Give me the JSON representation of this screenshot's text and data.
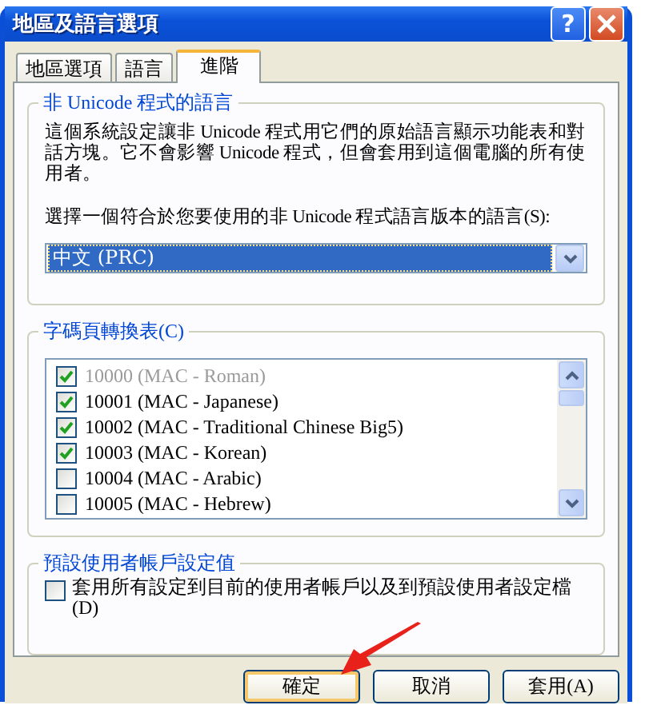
{
  "window": {
    "title": "地區及語言選項"
  },
  "title_buttons": [
    {
      "kind": "help",
      "label": "?"
    },
    {
      "kind": "close"
    }
  ],
  "tabs": [
    {
      "label": "地區選項",
      "selected": false
    },
    {
      "label": "語言",
      "selected": false
    },
    {
      "label": "進階",
      "selected": true
    }
  ],
  "language_group": {
    "legend": "非 Unicode 程式的語言",
    "description": "這個系統設定讓非 Unicode 程式用它們的原始語言顯示功能表和對話方塊。它不會影響 Unicode 程式，但會套用到這個電腦的所有使用者。",
    "prompt": "選擇一個符合於您要使用的非 Unicode 程式語言版本的語言(S):",
    "select": {
      "value": "中文 (PRC)"
    }
  },
  "codepage_group": {
    "legend": "字碼頁轉換表(C)",
    "items": [
      {
        "label": "10000 (MAC - Roman)",
        "checked": true,
        "disabled": true
      },
      {
        "label": "10001 (MAC - Japanese)",
        "checked": true,
        "disabled": false
      },
      {
        "label": "10002 (MAC - Traditional Chinese Big5)",
        "checked": true,
        "disabled": false
      },
      {
        "label": "10003 (MAC - Korean)",
        "checked": true,
        "disabled": false
      },
      {
        "label": "10004 (MAC - Arabic)",
        "checked": false,
        "disabled": false
      },
      {
        "label": "10005 (MAC - Hebrew)",
        "checked": false,
        "disabled": false
      }
    ]
  },
  "default_group": {
    "legend": "預設使用者帳戶設定值",
    "checkbox": {
      "label": "套用所有設定到目前的使用者帳戶以及到預設使用者設定檔(D)",
      "checked": false
    }
  },
  "buttons": [
    {
      "label": "確定",
      "default": true
    },
    {
      "label": "取消",
      "default": false
    },
    {
      "label": "套用(A)",
      "default": false
    }
  ]
}
